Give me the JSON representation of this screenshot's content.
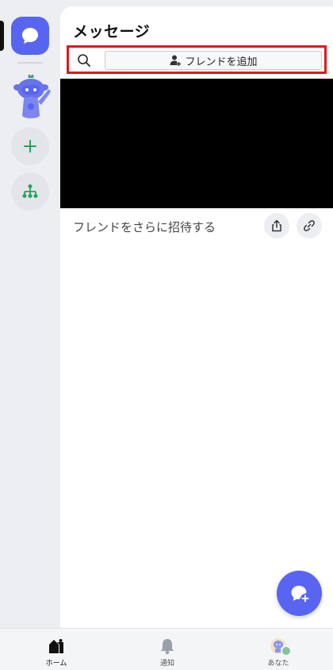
{
  "header": {
    "title": "メッセージ"
  },
  "search": {
    "icon": "search-icon"
  },
  "add_friend": {
    "label": "フレンドを追加",
    "icon": "person-add-icon"
  },
  "invite": {
    "text": "フレンドをさらに招待する"
  },
  "nav": {
    "home": "ホーム",
    "notifications": "通知",
    "you": "あなた"
  },
  "colors": {
    "accent": "#5865f2",
    "highlight_border": "#e3161d",
    "green": "#23a559",
    "online": "#80c79a"
  }
}
